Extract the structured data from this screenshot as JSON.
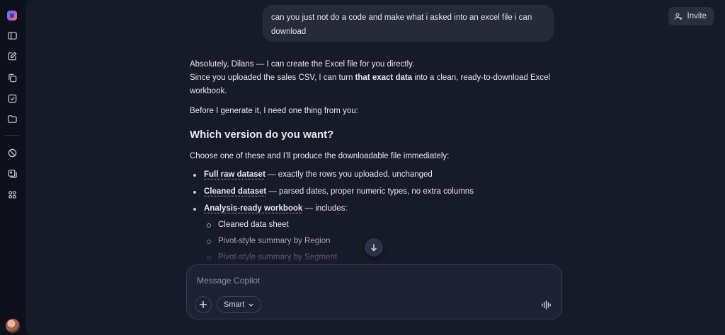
{
  "sidebar": {
    "logo_icon": "copilot-logo-icon",
    "items": [
      {
        "name": "sidebar-toggle",
        "icon": "panel-icon"
      },
      {
        "name": "new-chat",
        "icon": "compose-icon"
      },
      {
        "name": "pages",
        "icon": "copy-icon"
      },
      {
        "name": "tasks",
        "icon": "checkbox-icon"
      },
      {
        "name": "folders",
        "icon": "folder-icon"
      },
      {
        "name": "discover",
        "icon": "compass-icon"
      },
      {
        "name": "image-create",
        "icon": "image-icon"
      },
      {
        "name": "apps",
        "icon": "apps-icon"
      }
    ]
  },
  "header": {
    "invite_label": "Invite"
  },
  "conversation": {
    "user_message": "can you just not do a code and make what i asked into an excel file i can download",
    "reply": {
      "p1_line1": "Absolutely, Dilans — I can create the Excel file for you directly.",
      "p1_line2_pre": "Since you uploaded the sales CSV, I can turn ",
      "p1_line2_bold": "that exact data",
      "p1_line2_post": " into a clean, ready‑to‑download Excel workbook.",
      "p2": "Before I generate it, I need one thing from you:",
      "heading": "Which version do you want?",
      "p3": "Choose one of these and I’ll produce the downloadable file immediately:",
      "options": [
        {
          "title": "Full raw dataset",
          "desc": " — exactly the rows you uploaded, unchanged"
        },
        {
          "title": "Cleaned dataset",
          "desc": " — parsed dates, proper numeric types, no extra columns"
        },
        {
          "title": "Analysis‑ready workbook",
          "desc": " — includes:"
        }
      ],
      "sub_options": [
        "Cleaned data sheet",
        "Pivot‑style summary by Region",
        "Pivot‑style summary by Segment"
      ]
    }
  },
  "composer": {
    "placeholder": "Message Copilot",
    "mode_label": "Smart"
  }
}
